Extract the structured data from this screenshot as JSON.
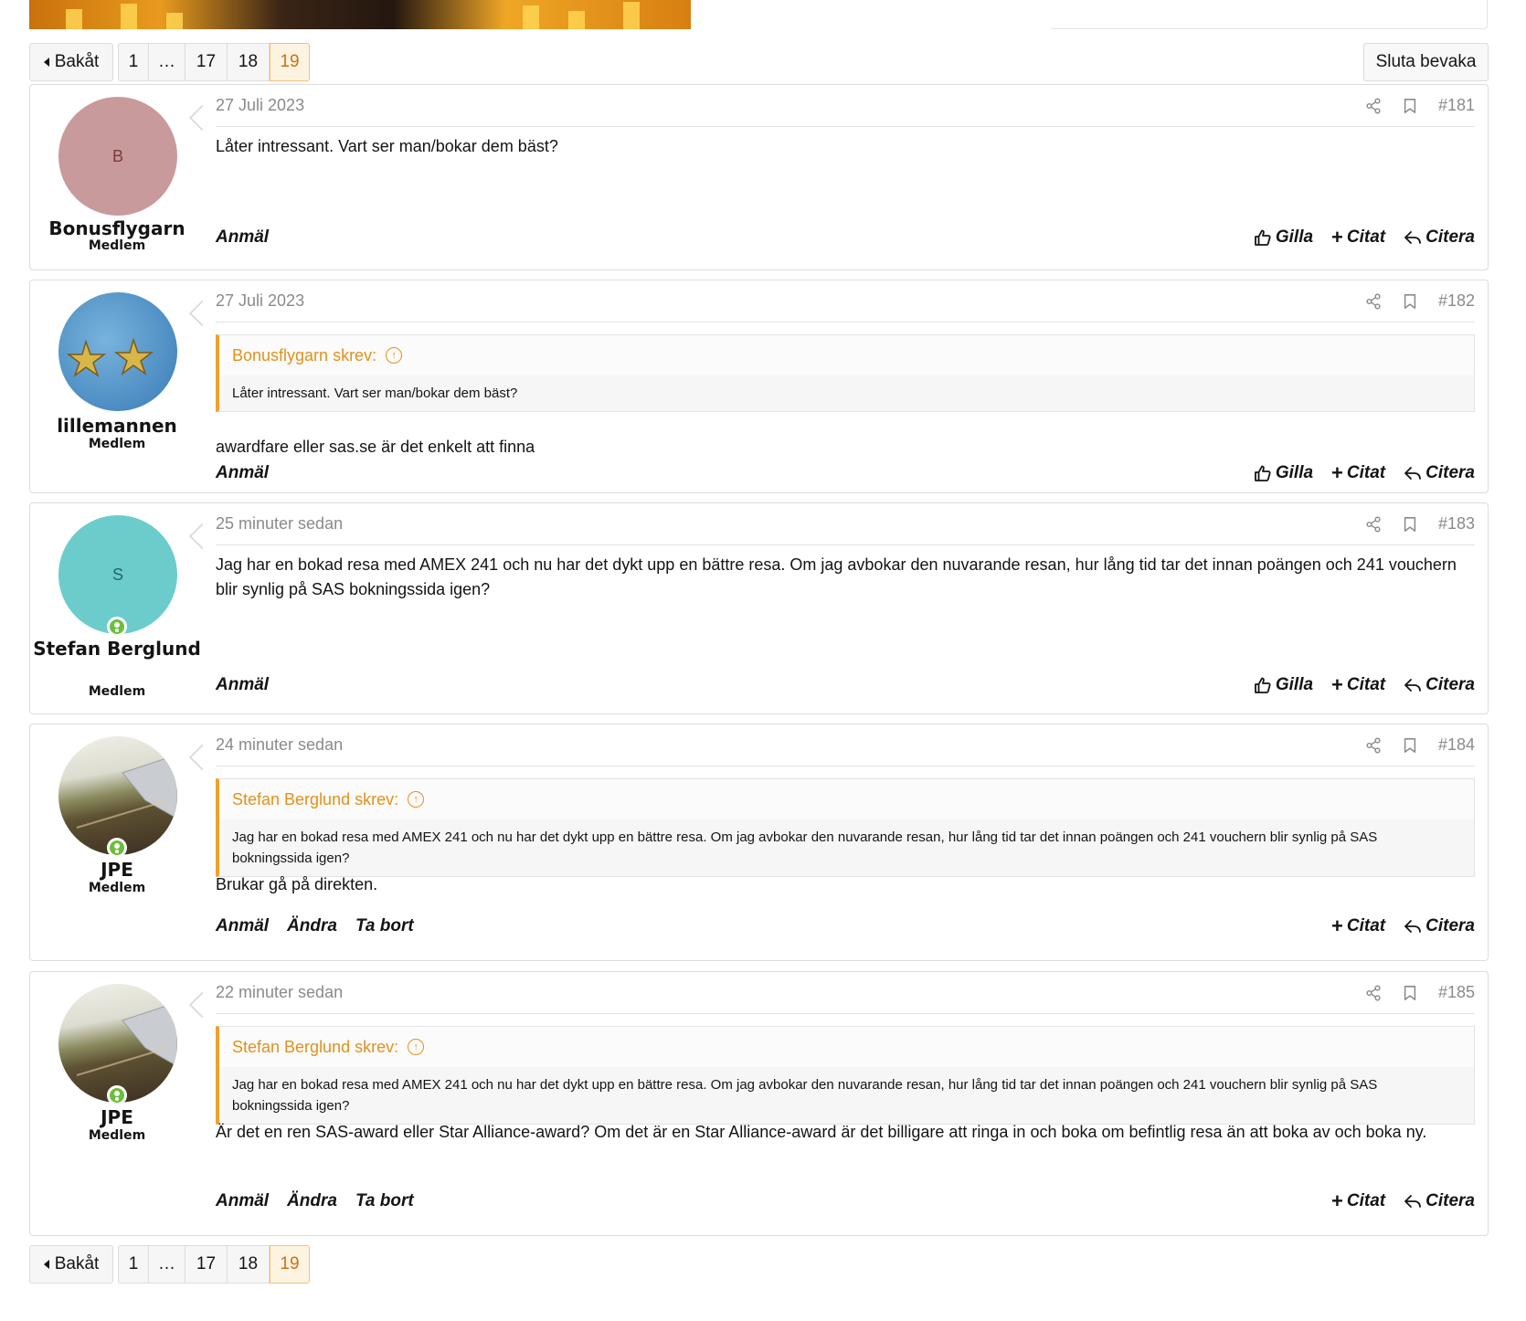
{
  "pagination": {
    "back_label": "Bakåt",
    "pages": [
      "1",
      "…",
      "17",
      "18",
      "19"
    ],
    "current": "19"
  },
  "watch_button": "Sluta bevaka",
  "posts": [
    {
      "author": "Bonusflygarn",
      "role": "Medlem",
      "avatar_letter": "B",
      "avatar_color": "#c99a9b",
      "date": "27 Juli 2023",
      "number": "#181",
      "body": "Låter intressant. Vart ser man/bokar dem bäst?",
      "actions_left": [
        "Anmäl"
      ],
      "like": "Gilla",
      "citat": "Citat",
      "citera": "Citera"
    },
    {
      "author": "lillemannen",
      "role": "Medlem",
      "date": "27 Juli 2023",
      "number": "#182",
      "quote_author": "Bonusflygarn skrev:",
      "quote_text": "Låter intressant. Vart ser man/bokar dem bäst?",
      "body": "awardfare eller sas.se är det enkelt att finna",
      "actions_left": [
        "Anmäl"
      ],
      "like": "Gilla",
      "citat": "Citat",
      "citera": "Citera"
    },
    {
      "author": "Stefan Berglund",
      "role": "Medlem",
      "avatar_letter": "S",
      "avatar_color": "#6ccccc",
      "date": "25 minuter sedan",
      "number": "#183",
      "body": "Jag har en bokad resa med AMEX 241 och nu har det dykt upp en bättre resa. Om jag avbokar den nuvarande resan, hur lång tid tar det innan poängen och 241 vouchern blir synlig på SAS bokningssida igen?",
      "actions_left": [
        "Anmäl"
      ],
      "like": "Gilla",
      "citat": "Citat",
      "citera": "Citera"
    },
    {
      "author": "JPE",
      "role": "Medlem",
      "date": "24 minuter sedan",
      "number": "#184",
      "quote_author": "Stefan Berglund skrev:",
      "quote_text": "Jag har en bokad resa med AMEX 241 och nu har det dykt upp en bättre resa. Om jag avbokar den nuvarande resan, hur lång tid tar det innan poängen och 241 vouchern blir synlig på SAS bokningssida igen?",
      "body": "Brukar gå på direkten.",
      "actions_left": [
        "Anmäl",
        "Ändra",
        "Ta bort"
      ],
      "citat": "Citat",
      "citera": "Citera"
    },
    {
      "author": "JPE",
      "role": "Medlem",
      "date": "22 minuter sedan",
      "number": "#185",
      "quote_author": "Stefan Berglund skrev:",
      "quote_text": "Jag har en bokad resa med AMEX 241 och nu har det dykt upp en bättre resa. Om jag avbokar den nuvarande resan, hur lång tid tar det innan poängen och 241 vouchern blir synlig på SAS bokningssida igen?",
      "body": "Är det en ren SAS-award eller Star Alliance-award? Om det är en Star Alliance-award är det billigare att ringa in och boka om befintlig resa än att boka av och boka ny.",
      "actions_left": [
        "Anmäl",
        "Ändra",
        "Ta bort"
      ],
      "citat": "Citat",
      "citera": "Citera"
    }
  ]
}
